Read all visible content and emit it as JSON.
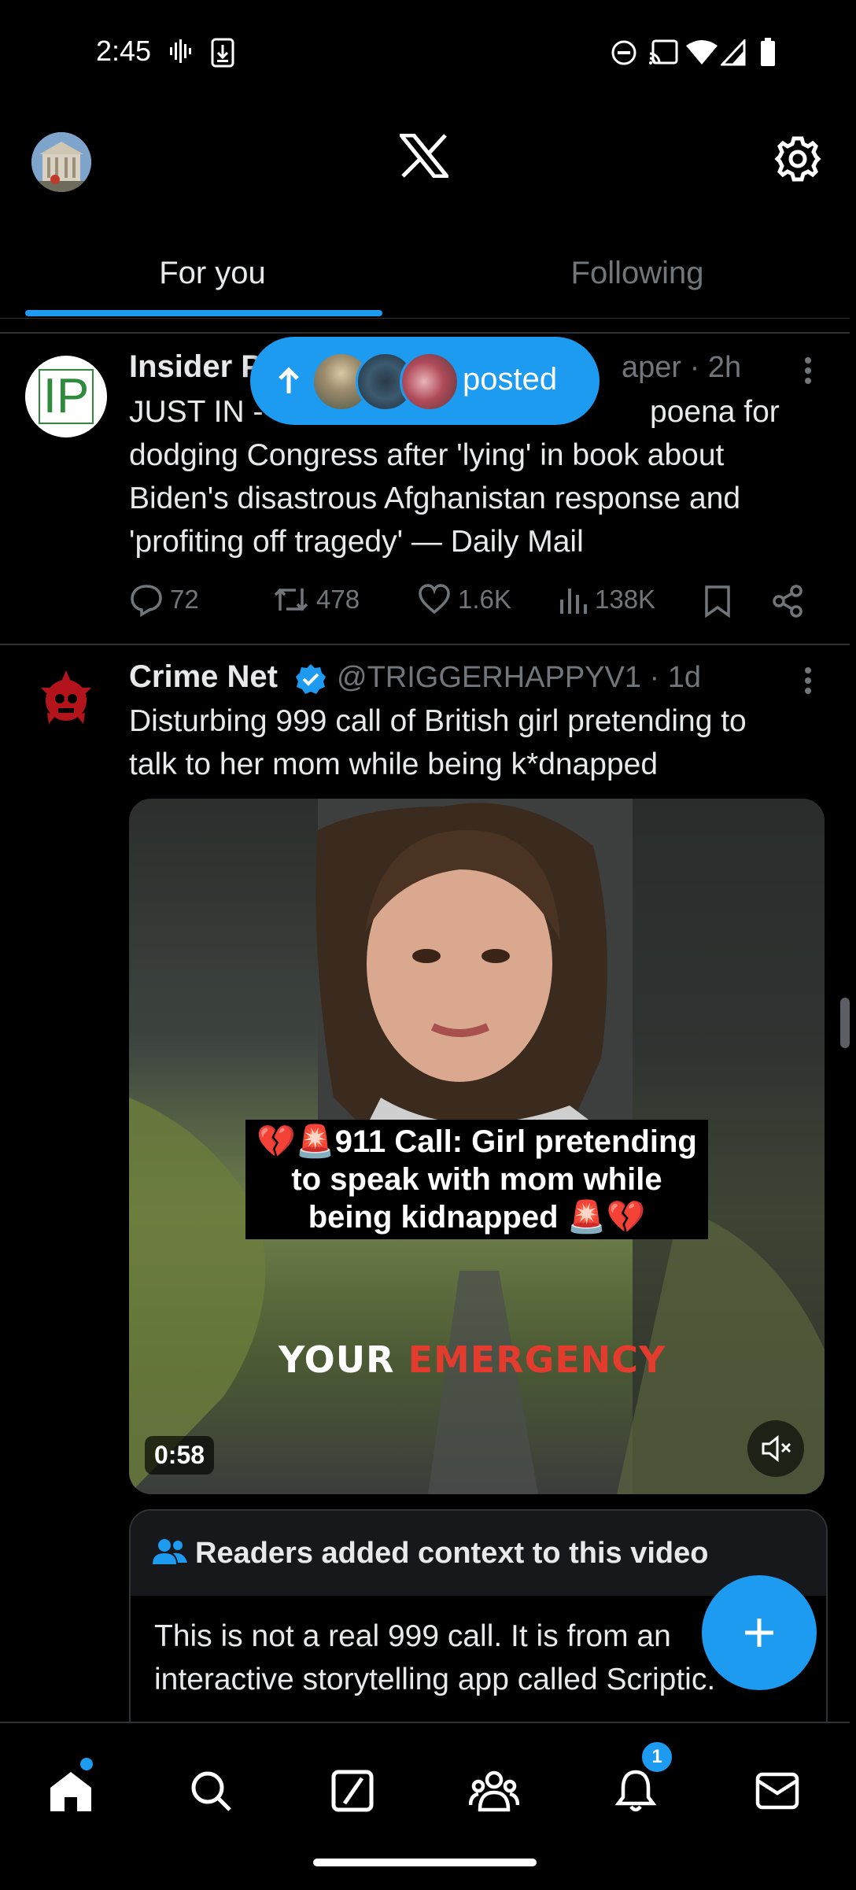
{
  "status_bar": {
    "time": "2:45",
    "icons": [
      "voicemail-icon",
      "download-icon",
      "dnd-icon",
      "cast-icon",
      "wifi-icon",
      "signal-icon",
      "battery-icon"
    ]
  },
  "header": {
    "logo": "X",
    "tabs": [
      {
        "label": "For you",
        "active": true
      },
      {
        "label": "Following",
        "active": false
      }
    ]
  },
  "new_posts_pill": {
    "label": "posted"
  },
  "posts": [
    {
      "avatar_text": "IP",
      "name": "Insider P",
      "meta": "aper · 2h",
      "text_lines": [
        "JUST IN -",
        "dodging Congress after 'lying' in book about",
        "Biden's disastrous Afghanistan response and",
        "'profiting off tragedy' — Daily Mail"
      ],
      "text_line1_tail": "poena for",
      "actions": {
        "replies": "72",
        "reposts": "478",
        "likes": "1.6K",
        "views": "138K"
      }
    },
    {
      "name": "Crime Net",
      "verified": true,
      "handle": "@TRIGGERHAPPYV1 · 1d",
      "text_lines": [
        "Disturbing 999 call of British girl pretending to",
        "talk to her mom while being k*dnapped"
      ],
      "video": {
        "caption_lines": [
          "💔🚨911 Call: Girl pretending",
          "to speak with mom while",
          "being kidnapped 🚨💔"
        ],
        "overlay_word1": "YOUR",
        "overlay_word2": "EMERGENCY",
        "duration": "0:58"
      },
      "context": {
        "title": "Readers added context to this video",
        "text_lines": [
          "This is not a real 999 call. It is from an",
          "interactive storytelling app called Scriptic."
        ]
      }
    }
  ],
  "bottom_nav": {
    "items": [
      "home-icon",
      "search-icon",
      "grok-icon",
      "communities-icon",
      "notifications-icon",
      "messages-icon"
    ],
    "notification_count": "1"
  },
  "colors": {
    "accent": "#1d9bf0",
    "background": "#000000",
    "secondary_text": "#71767b"
  }
}
